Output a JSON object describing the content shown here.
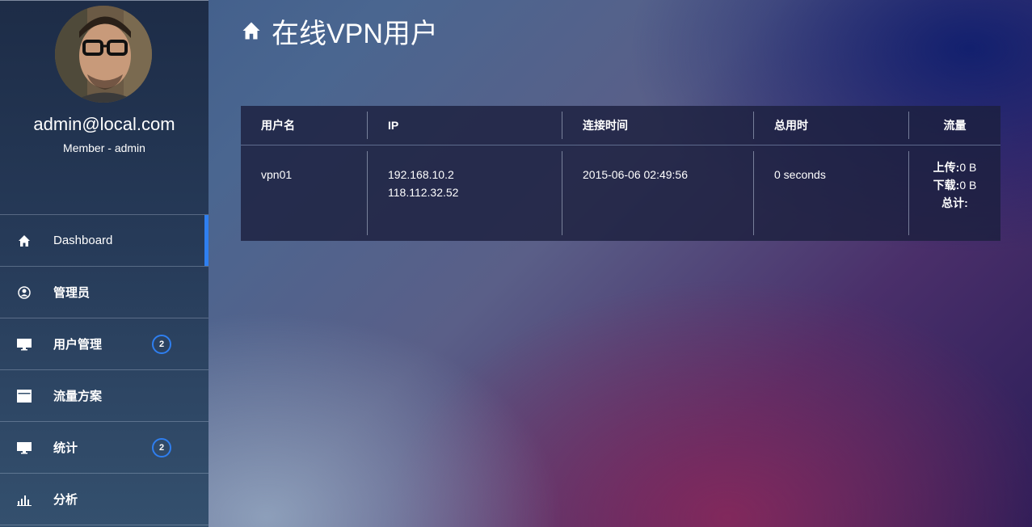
{
  "profile": {
    "email": "admin@local.com",
    "role": "Member - admin"
  },
  "nav": {
    "items": [
      {
        "label": "Dashboard",
        "icon": "home-icon",
        "active": true
      },
      {
        "label": "管理员",
        "icon": "user-circle-icon"
      },
      {
        "label": "用户管理",
        "icon": "monitor-icon",
        "badge": "2"
      },
      {
        "label": "流量方案",
        "icon": "window-icon"
      },
      {
        "label": "统计",
        "icon": "monitor-icon",
        "badge": "2"
      },
      {
        "label": "分析",
        "icon": "bar-chart-icon"
      }
    ]
  },
  "header": {
    "title": "在线VPN用户",
    "icon": "home-icon"
  },
  "table": {
    "columns": [
      "用户名",
      "IP",
      "连接时间",
      "总用时",
      "流量"
    ],
    "rows": [
      {
        "username": "vpn01",
        "ip_1": "192.168.10.2",
        "ip_2": "118.112.32.52",
        "connect_time": "2015-06-06 02:49:56",
        "duration": "0 seconds",
        "upload_label": "上传:",
        "upload_value": "0 B",
        "download_label": "下载:",
        "download_value": "0 B",
        "total_label": "总计:",
        "total_value": ""
      }
    ]
  },
  "colors": {
    "accent": "#2f7ff0",
    "sidebar_top": "#1d2c47",
    "table_bg": "#1c203e"
  }
}
